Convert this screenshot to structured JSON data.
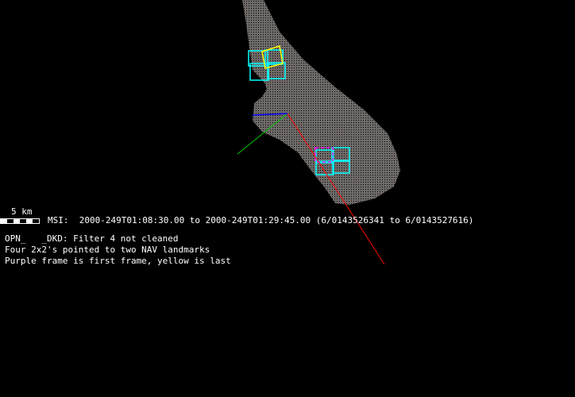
{
  "scale_bar": {
    "label": "5 km"
  },
  "header_line": "MSI:  2000-249T01:08:30.00 to 2000-249T01:29:45.00 (6/0143526341 to 6/0143527616)",
  "notes": [
    "OPN_   _DKD: Filter 4 not cleaned",
    "Four 2x2's pointed to two NAV landmarks",
    "Purple frame is first frame, yellow is last"
  ],
  "colors": {
    "background": "#000000",
    "asteroid": "#6e6a68",
    "frame": "#00ffff",
    "first_frame": "#ff00ff",
    "last_frame": "#ffff00",
    "axis_x": "#ff0000",
    "axis_y": "#00cc00",
    "axis_z": "#0000ff"
  }
}
